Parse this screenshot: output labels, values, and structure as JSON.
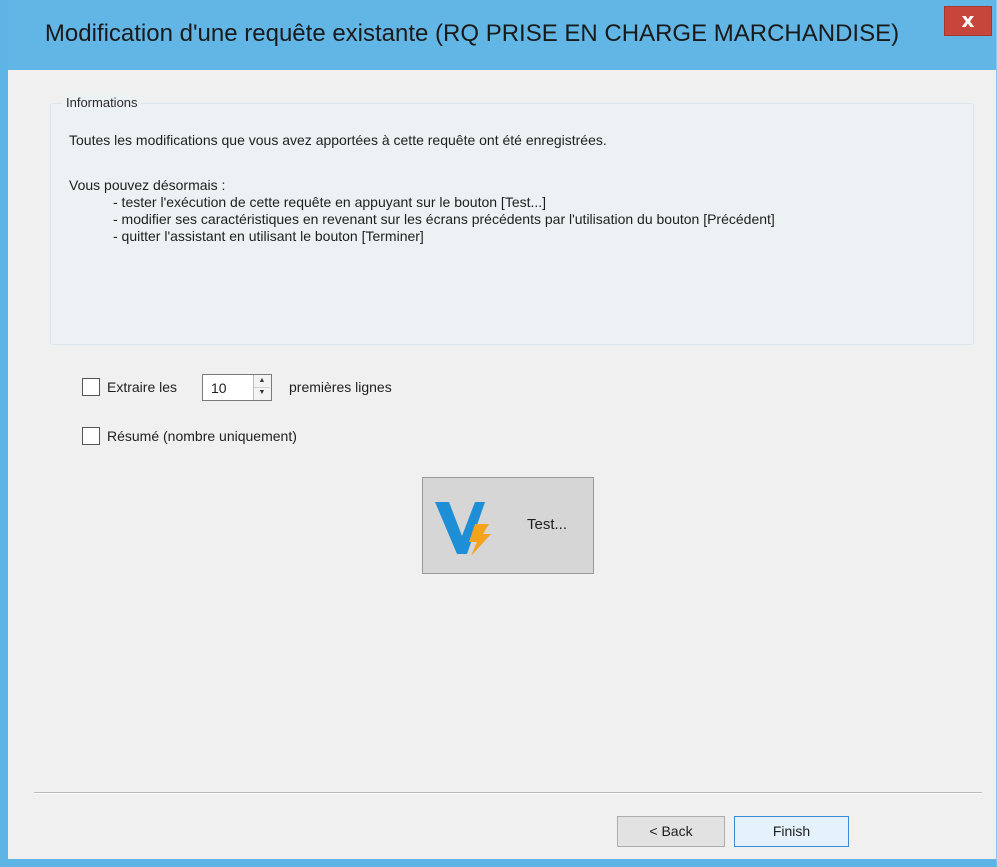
{
  "window": {
    "title": "Modification d'une requête existante (RQ PRISE EN CHARGE MARCHANDISE)",
    "close_label": "x"
  },
  "info": {
    "legend": "Informations",
    "line1": "Toutes les modifications que vous avez apportées à cette requête ont été enregistrées.",
    "line2": "Vous pouvez désormais :",
    "bullets": [
      "- tester l'exécution de cette requête en appuyant sur le bouton [Test...]",
      "- modifier ses caractéristiques en revenant sur les écrans précédents par l'utilisation du bouton [Précédent]",
      "- quitter l'assistant en utilisant le bouton [Terminer]"
    ]
  },
  "options": {
    "extract_checked": false,
    "extract_label": "Extraire les",
    "extract_count": "10",
    "extract_suffix": "premières lignes",
    "summary_checked": false,
    "summary_label": "Résumé (nombre uniquement)"
  },
  "test_button": {
    "label": "Test...",
    "icon": "v-lightning-logo-icon",
    "colors": {
      "v": "#1e8fd6",
      "bolt": "#f5a21c"
    }
  },
  "footer": {
    "back_label": "< Back",
    "finish_label": "Finish"
  },
  "colors": {
    "titlebar": "#62b6e6",
    "close": "#c7463c",
    "background": "#f0f0f0"
  }
}
